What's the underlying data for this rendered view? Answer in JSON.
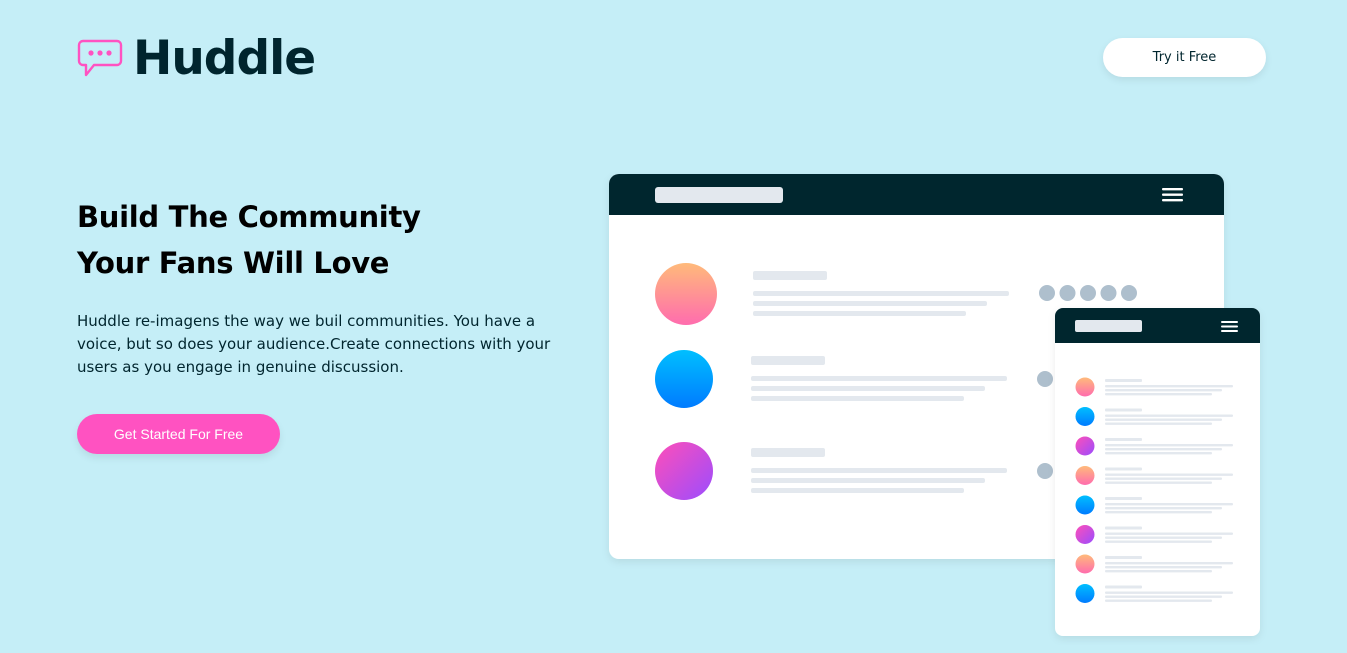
{
  "header": {
    "brand": "Huddle",
    "try_label": "Try it Free"
  },
  "hero": {
    "headline_line1": "Build The Community",
    "headline_line2": "Your Fans Will Love",
    "description": "Huddle re-imagens the way we buil communities. You have a voice, but so does your audience.Create connections with your users as you engage in genuine discussion.",
    "cta_label": "Get Started For Free"
  },
  "colors": {
    "background": "#c5eef7",
    "dark": "#00252e",
    "accent": "#ff52c1",
    "white": "#ffffff"
  },
  "icons": {
    "logo": "chat-bubble-icon",
    "menu": "hamburger-menu-icon"
  }
}
